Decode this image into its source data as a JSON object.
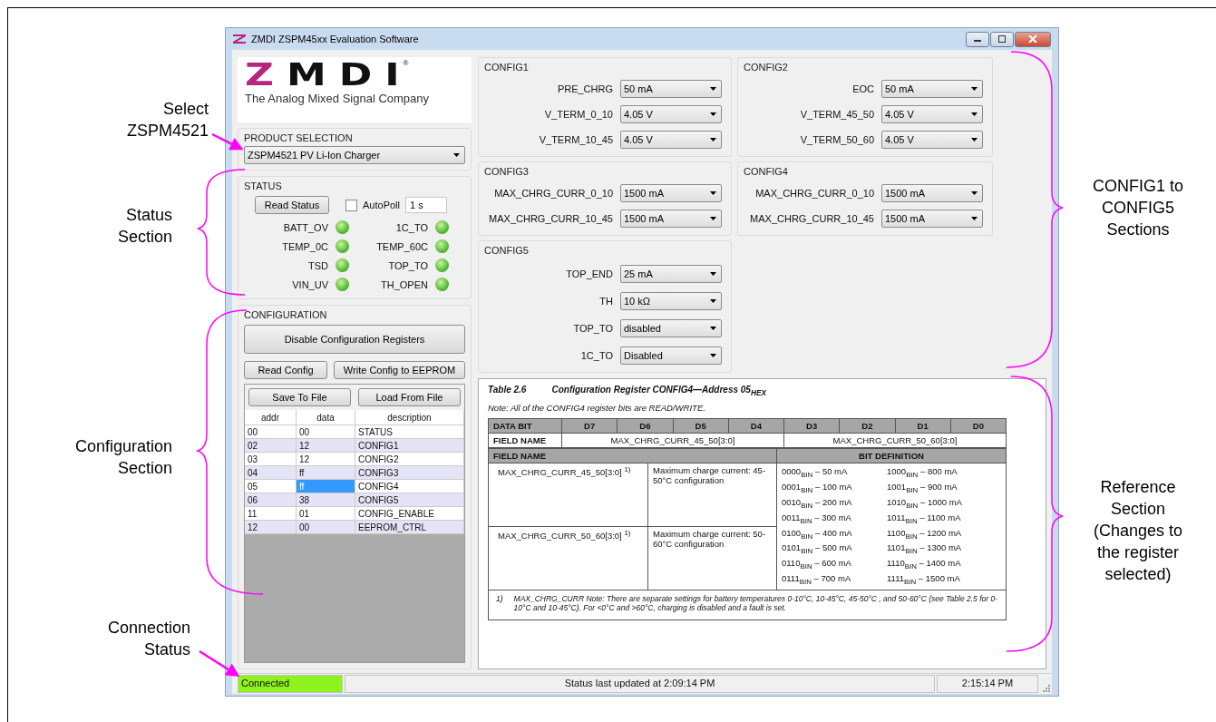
{
  "annotations": [
    {
      "text": "Select\nZSPM4521"
    },
    {
      "text": "Status\nSection"
    },
    {
      "text": "Configuration\nSection"
    },
    {
      "text": "Connection\nStatus"
    },
    {
      "text": "CONFIG1 to\nCONFIG5\nSections"
    },
    {
      "text": "Reference\nSection\n(Changes to\nthe register\nselected)"
    }
  ],
  "window": {
    "title": "ZMDI ZSPM45xx Evaluation Software"
  },
  "logo": {
    "name": "ZMDI",
    "mark": "®",
    "tagline": "The Analog Mixed Signal Company"
  },
  "product_selection": {
    "title": "PRODUCT SELECTION",
    "value": "ZSPM4521 PV Li-Ion Charger"
  },
  "status": {
    "title": "STATUS",
    "read_button": "Read Status",
    "autopoll": {
      "label": "AutoPoll",
      "checked": false,
      "interval": "1 s"
    },
    "indicators": [
      {
        "label": "BATT_OV",
        "on": true
      },
      {
        "label": "1C_TO",
        "on": true
      },
      {
        "label": "TEMP_0C",
        "on": true
      },
      {
        "label": "TEMP_60C",
        "on": true
      },
      {
        "label": "TSD",
        "on": true
      },
      {
        "label": "TOP_TO",
        "on": true
      },
      {
        "label": "VIN_UV",
        "on": true
      },
      {
        "label": "TH_OPEN",
        "on": true
      }
    ]
  },
  "configuration": {
    "title": "CONFIGURATION",
    "disable_button": "Disable Configuration Registers",
    "read_button": "Read Config",
    "write_button": "Write Config to EEPROM",
    "save_button": "Save To File",
    "load_button": "Load From File",
    "columns": [
      "addr",
      "data",
      "description"
    ],
    "rows": [
      {
        "cells": [
          "00",
          "00",
          "STATUS"
        ],
        "selected": false
      },
      {
        "cells": [
          "02",
          "12",
          "CONFIG1"
        ],
        "selected": false
      },
      {
        "cells": [
          "03",
          "12",
          "CONFIG2"
        ],
        "selected": false
      },
      {
        "cells": [
          "04",
          "ff",
          "CONFIG3"
        ],
        "selected": false
      },
      {
        "cells": [
          "05",
          "ff",
          "CONFIG4"
        ],
        "selected": true
      },
      {
        "cells": [
          "06",
          "38",
          "CONFIG5"
        ],
        "selected": false
      },
      {
        "cells": [
          "11",
          "01",
          "CONFIG_ENABLE"
        ],
        "selected": false
      },
      {
        "cells": [
          "12",
          "00",
          "EEPROM_CTRL"
        ],
        "selected": false
      }
    ]
  },
  "config_groups": [
    {
      "title": "CONFIG1",
      "fields": [
        {
          "label": "PRE_CHRG",
          "value": "50 mA"
        },
        {
          "label": "V_TERM_0_10",
          "value": "4.05 V"
        },
        {
          "label": "V_TERM_10_45",
          "value": "4.05 V"
        }
      ]
    },
    {
      "title": "CONFIG2",
      "fields": [
        {
          "label": "EOC",
          "value": "50 mA"
        },
        {
          "label": "V_TERM_45_50",
          "value": "4.05 V"
        },
        {
          "label": "V_TERM_50_60",
          "value": "4.05 V"
        }
      ]
    },
    {
      "title": "CONFIG3",
      "fields": [
        {
          "label": "MAX_CHRG_CURR_0_10",
          "value": "1500 mA"
        },
        {
          "label": "MAX_CHRG_CURR_10_45",
          "value": "1500 mA"
        }
      ]
    },
    {
      "title": "CONFIG4",
      "fields": [
        {
          "label": "MAX_CHRG_CURR_0_10",
          "value": "1500 mA"
        },
        {
          "label": "MAX_CHRG_CURR_10_45",
          "value": "1500 mA"
        }
      ]
    },
    {
      "title": "CONFIG5",
      "fields": [
        {
          "label": "TOP_END",
          "value": "25 mA"
        },
        {
          "label": "TH",
          "value": "10 kΩ"
        },
        {
          "label": "TOP_TO",
          "value": "disabled"
        },
        {
          "label": "1C_TO",
          "value": "Disabled"
        }
      ]
    }
  ],
  "reference": {
    "table_label": "Table 2.6",
    "caption": "Configuration Register CONFIG4—Address 05$_{HEX}$",
    "note": "Note: All of the CONFIG4 register bits are READ/WRITE.",
    "bit_header": "DATA BIT",
    "bits": [
      "D7",
      "D6",
      "D5",
      "D4",
      "D3",
      "D2",
      "D1",
      "D0"
    ],
    "field_name_label": "FIELD NAME",
    "fields": [
      "MAX_CHRG_CURR_45_50[3:0]",
      "MAX_CHRG_CURR_50_60[3:0]"
    ],
    "definition_headers": [
      "FIELD NAME",
      "BIT DEFINITION"
    ],
    "definitions": [
      {
        "field": "MAX_CHRG_CURR_45_50[3:0] $^{1)}$",
        "description": "Maximum charge current: 45-50°C configuration"
      },
      {
        "field": "MAX_CHRG_CURR_50_60[3:0] $^{1)}$",
        "description": "Maximum charge current: 50-60°C configuration"
      }
    ],
    "codes": [
      [
        "0000$_{BIN}$ – 50 mA",
        "1000$_{BIN}$ – 800 mA"
      ],
      [
        "0001$_{BIN}$ – 100 mA",
        "1001$_{BIN}$ – 900 mA"
      ],
      [
        "0010$_{BIN}$ – 200 mA",
        "1010$_{BIN}$ – 1000 mA"
      ],
      [
        "0011$_{BIN}$ – 300 mA",
        "1011$_{BIN}$ – 1100 mA"
      ],
      [
        "0100$_{BIN}$ – 400 mA",
        "1100$_{BIN}$ – 1200 mA"
      ],
      [
        "0101$_{BIN}$ – 500 mA",
        "1101$_{BIN}$ – 1300 mA"
      ],
      [
        "0110$_{BIN}$ – 600 mA",
        "1110$_{BIN}$ – 1400 mA"
      ],
      [
        "0111$_{BIN}$ – 700 mA",
        "1111$_{BIN}$ – 1500 mA"
      ]
    ],
    "footnote_mark": "1)",
    "footnote": "MAX_CHRG_CURR Note: There are separate settings for battery temperatures 0-10°C, 10-45°C, 45-50°C , and 50-60°C (see Table 2.5 for 0-10°C and 10-45°C). For <0°C and >60°C, charging is disabled and a fault is set."
  },
  "status_bar": {
    "connection": "Connected",
    "connected": true,
    "message": "Status last updated at 2:09:14 PM",
    "time": "2:15:14 PM"
  }
}
